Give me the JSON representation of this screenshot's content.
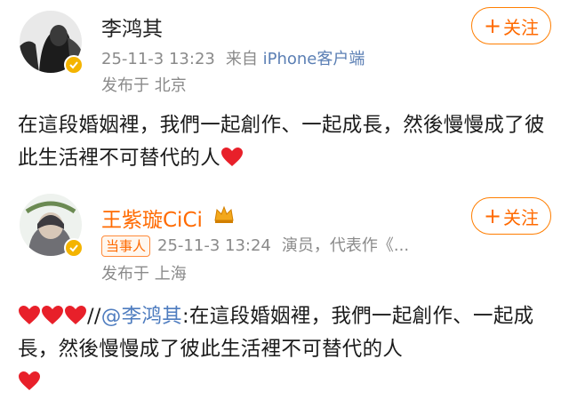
{
  "post1": {
    "author": "李鸿其",
    "timestamp": "25-11-3 13:23",
    "source_prefix": "来自",
    "source": "iPhone客户端",
    "location": "发布于 北京",
    "follow_label": "关注",
    "content": "在這段婚姻裡，我們一起創作、一起成長，然後慢慢成了彼此生活裡不可替代的人"
  },
  "post2": {
    "author": "王紫璇CiCi",
    "badge": "当事人",
    "timestamp": "25-11-3 13:24",
    "bio": "演员，代表作《...",
    "location": "发布于 上海",
    "follow_label": "关注",
    "repost_sep": "//",
    "mention": "@李鸿其",
    "content": ":在這段婚姻裡，我們一起創作、一起成長，然後慢慢成了彼此生活裡不可替代的人"
  },
  "colors": {
    "accent": "#ff6a00",
    "link": "#4e7cbf",
    "verified": "#f4b400",
    "heart": "#e8202a"
  }
}
